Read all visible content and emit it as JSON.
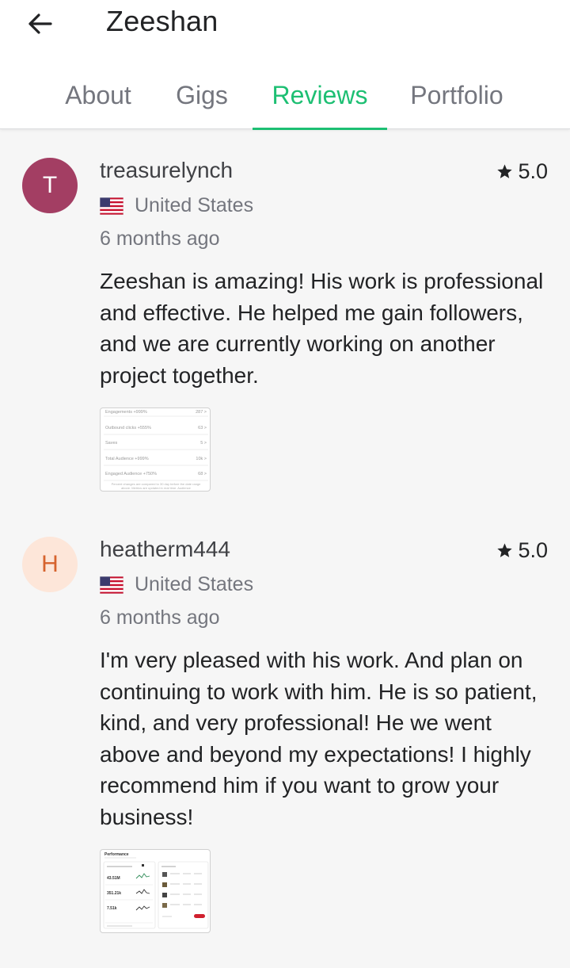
{
  "header": {
    "title": "Zeeshan",
    "back_icon": "arrow-left-icon"
  },
  "tabs": [
    {
      "label": "About",
      "active": false
    },
    {
      "label": "Gigs",
      "active": false
    },
    {
      "label": "Reviews",
      "active": true
    },
    {
      "label": "Portfolio",
      "active": false
    }
  ],
  "colors": {
    "accent": "#1dbf73",
    "avatar_t": "#a33e63",
    "avatar_h": "#fde6d9"
  },
  "reviews": [
    {
      "avatar_letter": "T",
      "username": "treasurelynch",
      "rating": "5.0",
      "country": "United States",
      "time": "6 months ago",
      "text": "Zeeshan is amazing! His work is professional and effective. He helped me gain followers, and we are currently working on another project together.",
      "thumb": {
        "rows": [
          {
            "label": "Engagements +999%",
            "value": "287 >"
          },
          {
            "label": "Outbound clicks +555%",
            "value": "63 >"
          },
          {
            "label": "Saves",
            "value": "5 >"
          },
          {
            "label": "Total Audience +999%",
            "value": "10k >"
          },
          {
            "label": "Engaged Audience +750%",
            "value": "68 >"
          }
        ],
        "note": "Percent changes are compared to 30 day before the date range above. Metrics are updated in real time. Audience"
      }
    },
    {
      "avatar_letter": "H",
      "username": "heatherm444",
      "rating": "5.0",
      "country": "United States",
      "time": "6 months ago",
      "text": "I'm very pleased with his work. And plan on continuing to work with him. He is so patient, kind, and very professional! He we went above and beyond my expectations! I highly recommend him if you want to grow your business!",
      "thumb": {
        "title": "Performance",
        "metrics": [
          "43.51M",
          "351.21k",
          "7.51k"
        ]
      }
    }
  ]
}
